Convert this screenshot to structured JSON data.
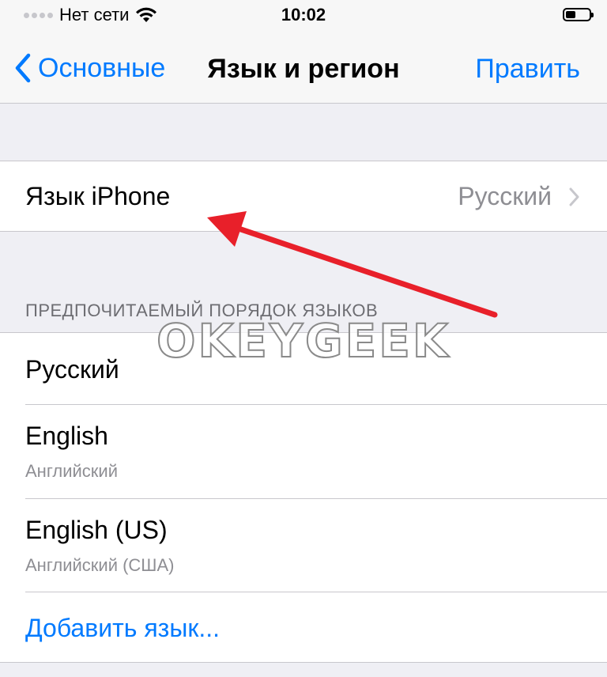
{
  "status_bar": {
    "carrier": "Нет сети",
    "time": "10:02"
  },
  "nav": {
    "back_label": "Основные",
    "title": "Язык и регион",
    "edit_label": "Править"
  },
  "iphone_language": {
    "label": "Язык iPhone",
    "value": "Русский"
  },
  "preferred": {
    "header": "ПРЕДПОЧИТАЕМЫЙ ПОРЯДОК ЯЗЫКОВ",
    "items": [
      {
        "title": "Русский",
        "subtitle": ""
      },
      {
        "title": "English",
        "subtitle": "Английский"
      },
      {
        "title": "English (US)",
        "subtitle": "Английский (США)"
      }
    ],
    "add_label": "Добавить язык..."
  },
  "watermark": "OKEYGEEK",
  "colors": {
    "accent": "#007aff",
    "arrow": "#e8202a",
    "background": "#efeff4"
  }
}
